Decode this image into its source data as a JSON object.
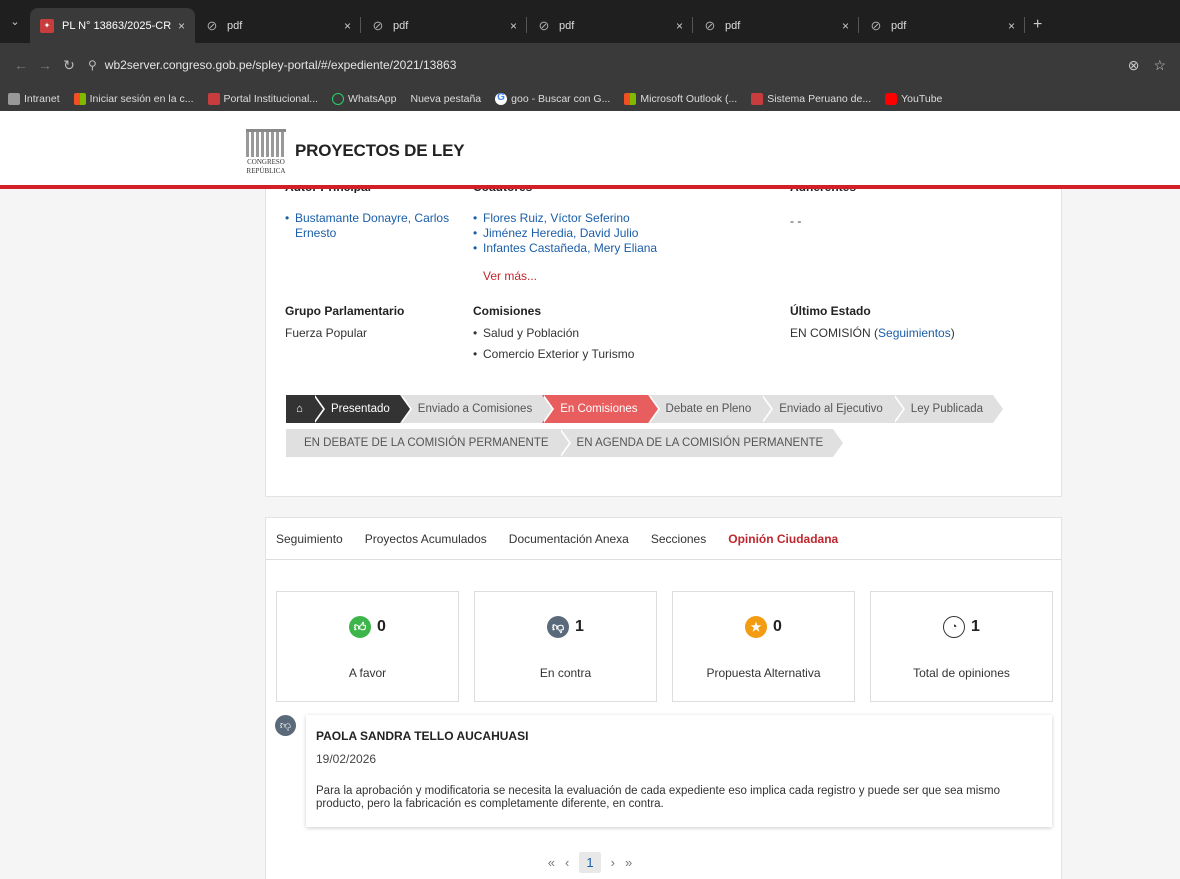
{
  "browser": {
    "tabs": [
      {
        "label": "PL N° 13863/2025-CR",
        "active": true,
        "icon": "congress-crest-icon"
      },
      {
        "label": "pdf",
        "active": false,
        "icon": "globe-icon"
      },
      {
        "label": "pdf",
        "active": false,
        "icon": "globe-icon"
      },
      {
        "label": "pdf",
        "active": false,
        "icon": "globe-icon"
      },
      {
        "label": "pdf",
        "active": false,
        "icon": "globe-icon"
      },
      {
        "label": "pdf",
        "active": false,
        "icon": "globe-icon"
      }
    ],
    "tab_close": "×",
    "new_tab": "+",
    "url": "wb2server.congreso.gob.pe/spley-portal/#/expediente/2021/13863",
    "bookmarks": [
      {
        "label": "Intranet",
        "icon": "gray"
      },
      {
        "label": "Iniciar sesión en la c...",
        "icon": "ms"
      },
      {
        "label": "Portal Institucional...",
        "icon": "crest"
      },
      {
        "label": "WhatsApp",
        "icon": "wa"
      },
      {
        "label": "Nueva pestaña",
        "icon": "none"
      },
      {
        "label": "goo - Buscar con G...",
        "icon": "google"
      },
      {
        "label": "Microsoft Outlook (...",
        "icon": "ms"
      },
      {
        "label": "Sistema Peruano de...",
        "icon": "crest"
      },
      {
        "label": "YouTube",
        "icon": "yt"
      }
    ]
  },
  "header": {
    "title": "PROYECTOS DE LEY",
    "logo_text_1": "CONGRESO",
    "logo_text_2": "REPÚBLICA"
  },
  "info": {
    "autor_label": "Autor Principal",
    "autor": "Bustamante Donayre, Carlos Ernesto",
    "coautores_label": "Coautores",
    "coautores": [
      "Flores Ruiz, Víctor Seferino",
      "Jiménez Heredia, David Julio",
      "Infantes Castañeda, Mery Eliana"
    ],
    "ver_mas": "Ver más...",
    "adherentes_label": "Adherentes",
    "adherentes": "- -",
    "grupo_label": "Grupo Parlamentario",
    "grupo": "Fuerza Popular",
    "comisiones_label": "Comisiones",
    "comisiones": [
      "Salud y Población",
      "Comercio Exterior y Turismo"
    ],
    "estado_label": "Último Estado",
    "estado": "EN COMISIÓN (",
    "estado_link": "Seguimientos",
    "estado_close": ")"
  },
  "steps": {
    "row1": [
      "Presentado",
      "Enviado a Comisiones",
      "En Comisiones",
      "Debate en Pleno",
      "Enviado al Ejecutivo",
      "Ley Publicada"
    ],
    "row2": [
      "EN DEBATE DE LA COMISIÓN PERMANENTE",
      "EN AGENDA DE LA COMISIÓN PERMANENTE"
    ],
    "home_icon": "⌂"
  },
  "tabs": [
    "Seguimiento",
    "Proyectos Acumulados",
    "Documentación Anexa",
    "Secciones",
    "Opinión Ciudadana"
  ],
  "stats": [
    {
      "count": "0",
      "label": "A favor",
      "color": "#3cb54a",
      "icon": "thumbs-up-icon"
    },
    {
      "count": "1",
      "label": "En contra",
      "color": "#5a6a7a",
      "icon": "thumbs-down-icon"
    },
    {
      "count": "0",
      "label": "Propuesta Alternativa",
      "color": "#f39c12",
      "icon": "star-icon"
    },
    {
      "count": "1",
      "label": "Total de opiniones",
      "color": "#ffffff",
      "icon": "chat-icon"
    }
  ],
  "comment": {
    "name": "PAOLA SANDRA TELLO AUCAHUASI",
    "date": "19/02/2026",
    "text": "Para la aprobación y modificatoria se necesita la evaluación de cada expediente eso implica cada registro y puede ser que sea mismo producto, pero la fabricación es completamente diferente, en contra."
  },
  "pager": {
    "first": "«",
    "prev": "‹",
    "current": "1",
    "next": "›",
    "last": "»"
  }
}
